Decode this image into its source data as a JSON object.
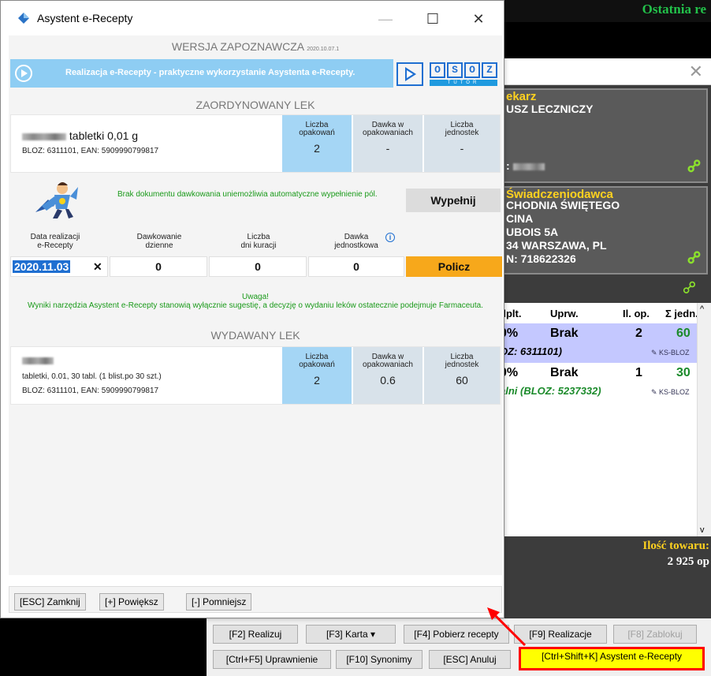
{
  "background": {
    "top_title": "Ostatnia re",
    "box1": {
      "title": "ekarz",
      "line1": "USZ LECZNICZY",
      "line2": ":"
    },
    "box2": {
      "title": "Świadczeniodawca",
      "line1": "CHODNIA ŚWIĘTEGO",
      "line2": "CINA",
      "line3": "UBOIS 5A",
      "line4": "34 WARSZAWA, PL",
      "line5": "N: 718622326"
    },
    "table": {
      "headers": [
        "dplt.",
        "Uprw.",
        "Il. op.",
        "Σ jedn."
      ],
      "rows": [
        {
          "refund": "0%",
          "entitlement": "Brak",
          "packs": "2",
          "units": "60",
          "bloz": "OZ: 6311101)",
          "tag": "KS-BLOZ"
        },
        {
          "refund": "0%",
          "entitlement": "Brak",
          "packs": "1",
          "units": "30",
          "bloz": "alni (BLOZ: 5237332)",
          "tag": "KS-BLOZ"
        }
      ]
    },
    "qty_label": "Ilość towaru:",
    "qty_value": "2 925 op",
    "buttons": {
      "realizuj": "[F2] Realizuj",
      "karta": "[F3] Karta ▾",
      "pobierz": "[F4] Pobierz recepty",
      "realizacje": "[F9] Realizacje",
      "zablokuj": "[F8] Zablokuj",
      "uprawnienie": "[Ctrl+F5] Uprawnienie",
      "synonimy": "[F10] Synonimy",
      "anuluj": "[ESC] Anuluj",
      "asystent": "[Ctrl+Shift+K] Asystent e-Recepty"
    }
  },
  "dialog": {
    "title": "Asystent e-Recepty",
    "version_main": "WERSJA ZAPOZNAWCZA",
    "version_num": "2020.10.07.1",
    "banner_text": "Realizacja e-Recepty - praktyczne wykorzystanie Asystenta e-Recepty.",
    "osoz_letters": [
      "O",
      "S",
      "O",
      "Z"
    ],
    "osoz_tutor": "TUTOR",
    "ordered_title": "ZAORDYNOWANY LEK",
    "ordered": {
      "name": "tabletki 0,01 g",
      "meta": "BLOZ: 6311101, EAN: 5909990799817",
      "stats": [
        {
          "label1": "Liczba",
          "label2": "opakowań",
          "value": "2"
        },
        {
          "label1": "Dawka w",
          "label2": "opakowaniach",
          "value": "-"
        },
        {
          "label1": "Liczba",
          "label2": "jednostek",
          "value": "-"
        }
      ]
    },
    "no_dosage_info": "Brak dokumentu dawkowania uniemożliwia automatyczne wypełnienie pól.",
    "fill_button": "Wypełnij",
    "columns": [
      {
        "l1": "Data realizacji",
        "l2": "e-Recepty"
      },
      {
        "l1": "Dawkowanie",
        "l2": "dzienne"
      },
      {
        "l1": "Liczba",
        "l2": "dni kuracji"
      },
      {
        "l1": "Dawka",
        "l2": "jednostkowa"
      }
    ],
    "inputs": {
      "date": "2020.11.03",
      "clear": "✕",
      "daily": "0",
      "days": "0",
      "unit": "0"
    },
    "calc_button": "Policz",
    "warning_title": "Uwaga!",
    "warning_text": "Wyniki narzędzia Asystent e-Recepty stanowią wyłącznie sugestię, a decyzję o wydaniu leków ostatecznie podejmuje Farmaceuta.",
    "dispensed_title": "WYDAWANY LEK",
    "dispensed": {
      "name_line": "tabletki, 0.01, 30 tabl. (1 blist.po 30 szt.)",
      "meta": "BLOZ: 6311101, EAN: 5909990799817",
      "stats": [
        {
          "label1": "Liczba",
          "label2": "opakowań",
          "value": "2"
        },
        {
          "label1": "Dawka w",
          "label2": "opakowaniach",
          "value": "0.6"
        },
        {
          "label1": "Liczba",
          "label2": "jednostek",
          "value": "60"
        }
      ]
    },
    "footer": {
      "close": "[ESC] Zamknij",
      "zoom_in": "[+] Powiększ",
      "zoom_out": "[-] Pomniejsz"
    }
  },
  "colors": {
    "accent_blue": "#1f6fd1",
    "stat_blue": "#a5d6f5",
    "warning_green": "#1a9a1a",
    "calc_orange": "#f7a81b",
    "highlight_red": "#ff0000"
  }
}
